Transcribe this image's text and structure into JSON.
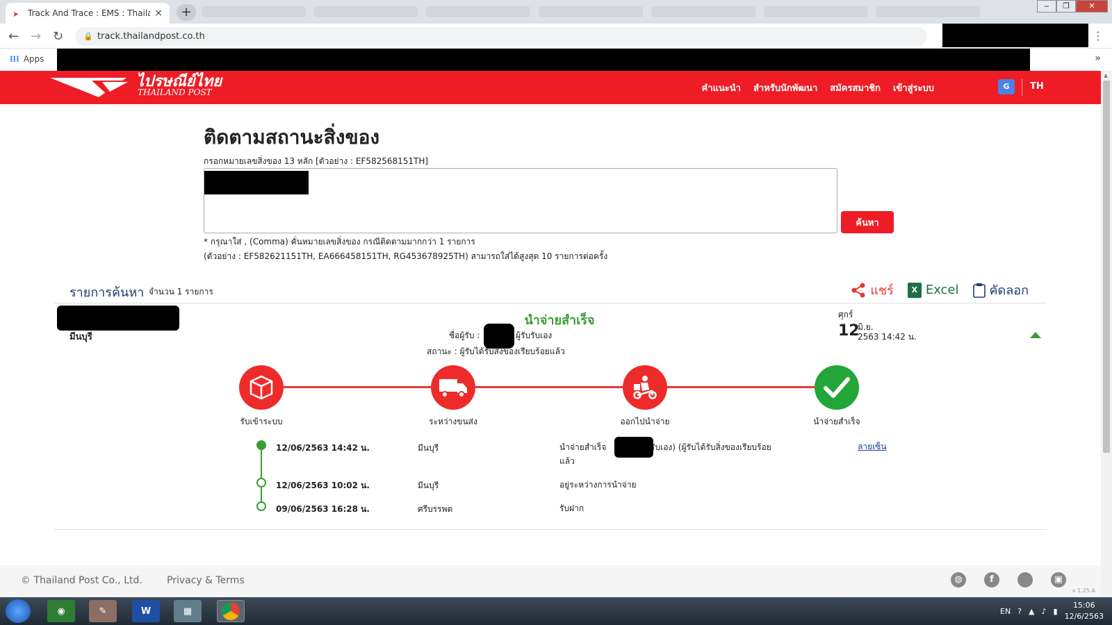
{
  "browser": {
    "tab_title": "Track And Trace : EMS : Thailand",
    "tab_close": "×",
    "new_tab": "+",
    "url": "track.thailandpost.co.th",
    "bookmarks_apps": "Apps",
    "bookmarks_more": "»"
  },
  "site": {
    "logo_text": "ไปรษณีย์ไทย",
    "logo_sub": "THAILAND POST",
    "nav": [
      "คำแนะนำ",
      "สำหรับนักพัฒนา",
      "สมัครสมาชิก",
      "เข้าสู่ระบบ"
    ],
    "language": "TH"
  },
  "search": {
    "title": "ติดตามสถานะสิ่งของ",
    "hint": "กรอกหมายเลขสิ่งของ 13 หลัก [ตัวอย่าง : EF582568151TH]",
    "button": "ค้นหา",
    "note1": "* กรุณาใส่ , (Comma) คั่นหมายเลขสิ่งของ กรณีติดตามมากกว่า 1 รายการ",
    "note2": "(ตัวอย่าง : EF582621151TH, EA666458151TH, RG453678925TH) สามารถใส่ได้สูงสุด 10 รายการต่อครั้ง"
  },
  "results": {
    "title": "รายการค้นหา",
    "count": "จำนวน 1 รายการ",
    "share": "แชร์",
    "excel": "Excel",
    "copy": "คัดลอก",
    "item": {
      "origin": "มีนบุรี",
      "status_title": "นำจ่ายสำเร็จ",
      "recipient_label": "ชื่อผู้รับ :",
      "recipient_suffix": "ผู้รับรับเอง",
      "status_line": "สถานะ : ผู้รับได้รับสิ่งของเรียบร้อยแล้ว",
      "day_name": "ศุกร์",
      "day_num": "12",
      "month": "มิ.ย.",
      "year_time": "2563 14:42 น."
    },
    "steps": [
      {
        "label": "รับเข้าระบบ",
        "icon": "box-icon"
      },
      {
        "label": "ระหว่างขนส่ง",
        "icon": "truck-icon"
      },
      {
        "label": "ออกไปนำจ่าย",
        "icon": "delivery-scooter-icon"
      },
      {
        "label": "นำจ่ายสำเร็จ",
        "icon": "checkmark-icon"
      }
    ],
    "timeline": [
      {
        "date": "12/06/2563 14:42 น.",
        "place": "มีนบุรี",
        "desc_a": "นำจ่ายสำเร็จ",
        "desc_b": "รับเอง) (ผู้รับได้รับสิ่งของเรียบร้อย",
        "desc_c": "แล้ว",
        "link": "ลายเซ็น"
      },
      {
        "date": "12/06/2563 10:02 น.",
        "place": "มีนบุรี",
        "desc": "อยู่ระหว่างการนำจ่าย"
      },
      {
        "date": "09/06/2563 16:28 น.",
        "place": "ศรีบรรพต",
        "desc": "รับฝาก"
      }
    ]
  },
  "footer": {
    "copyright": "© Thailand Post Co., Ltd.",
    "privacy": "Privacy & Terms",
    "version": "v 1.25.A"
  },
  "taskbar": {
    "lang": "EN",
    "time": "15:06",
    "date": "12/6/2563"
  },
  "colors": {
    "brand_red": "#ee1c25",
    "success_green": "#3a9d32",
    "link_blue": "#1a3e9e"
  }
}
